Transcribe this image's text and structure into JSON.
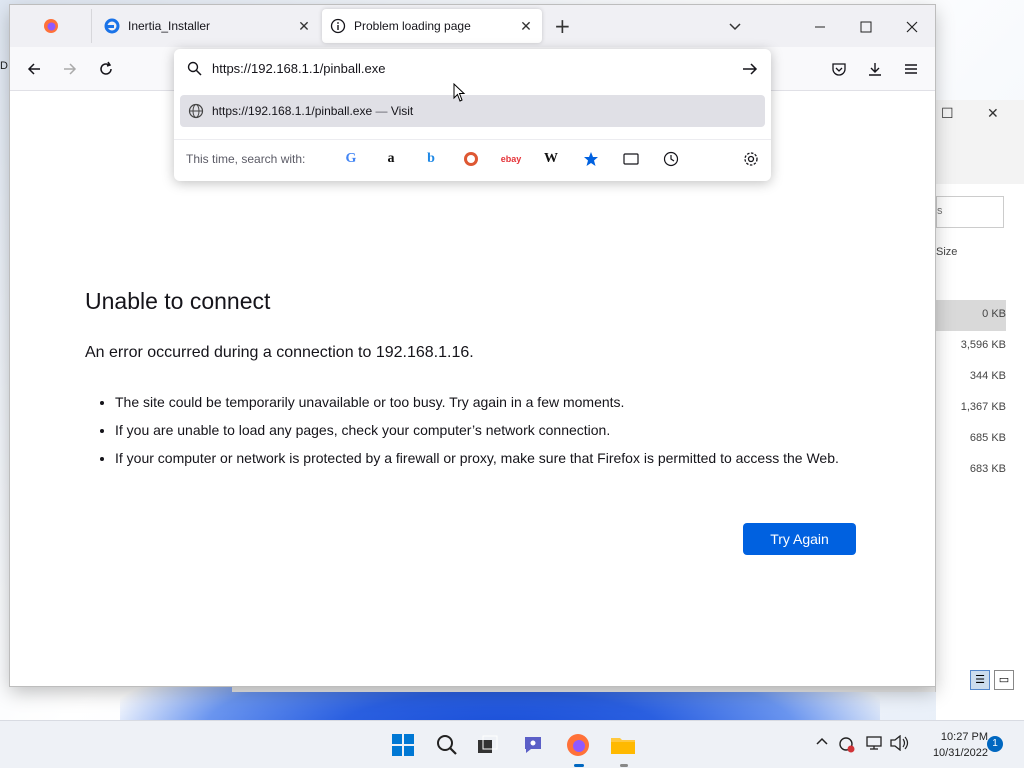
{
  "browser": {
    "tabs": [
      {
        "label": ""
      },
      {
        "label": "Inertia_Installer"
      },
      {
        "label": "Problem loading page"
      }
    ],
    "url_input": "https://192.168.1.1/pinball.exe",
    "suggestion": {
      "url": "https://192.168.1.1/pinball.exe",
      "separator": "—",
      "action": "Visit"
    },
    "search_with_label": "This time, search with:",
    "engines": [
      "Google",
      "Amazon",
      "Bing",
      "DuckDuckGo",
      "eBay",
      "Wikipedia",
      "Bookmarks",
      "Tabs",
      "History",
      "Settings"
    ]
  },
  "error": {
    "title": "Unable to connect",
    "description": "An error occurred during a connection to 192.168.1.16.",
    "bullets": [
      "The site could be temporarily unavailable or too busy. Try again in a few moments.",
      "If you are unable to load any pages, check your computer’s network connection.",
      "If your computer or network is protected by a firewall or proxy, make sure that Firefox is permitted to access the Web."
    ],
    "button": "Try Again"
  },
  "explorer": {
    "search_placeholder": "s",
    "column_size": "Size",
    "sizes": [
      "0 KB",
      "3,596 KB",
      "344 KB",
      "1,367 KB",
      "685 KB",
      "683 KB"
    ]
  },
  "left_edge_letter": "D",
  "taskbar": {
    "time": "10:27 PM",
    "date": "10/31/2022",
    "notification_count": "1"
  },
  "colors": {
    "accent": "#0061e0",
    "tabstrip": "#f0f0f4",
    "taskbar": "#eef1f6"
  }
}
